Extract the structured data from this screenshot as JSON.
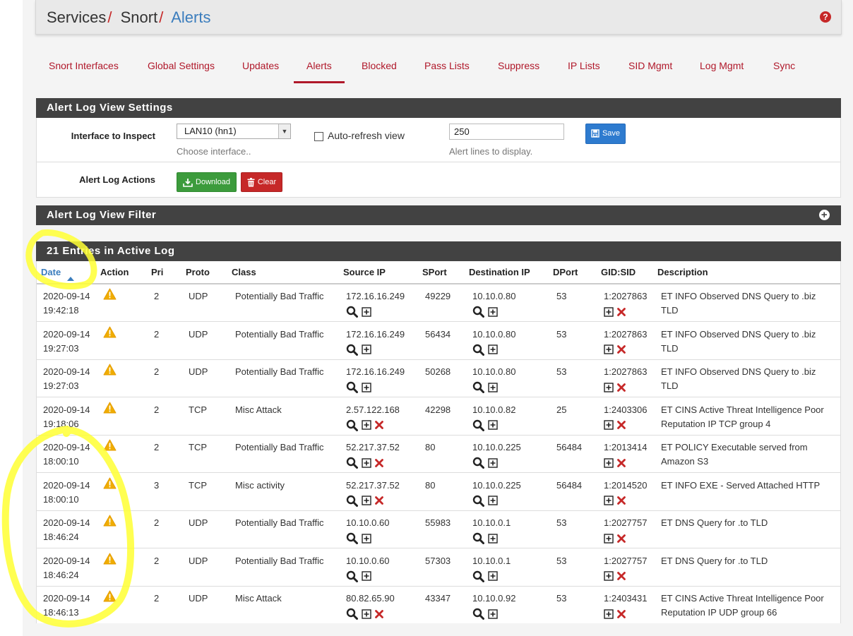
{
  "breadcrumb": {
    "part1": "Services",
    "part2": "Snort",
    "current": "Alerts",
    "separator": "/"
  },
  "tabs": [
    "Snort Interfaces",
    "Global Settings",
    "Updates",
    "Alerts",
    "Blocked",
    "Pass Lists",
    "Suppress",
    "IP Lists",
    "SID Mgmt",
    "Log Mgmt",
    "Sync"
  ],
  "active_tab": "Alerts",
  "settings": {
    "title": "Alert Log View Settings",
    "interface_label": "Interface to Inspect",
    "interface_value": "LAN10 (hn1)",
    "interface_hint": "Choose interface..",
    "autorefresh_label": "Auto-refresh view",
    "lines_value": "250",
    "lines_hint": "Alert lines to display.",
    "save_label": "Save",
    "actions_label": "Alert Log Actions",
    "download_label": "Download",
    "clear_label": "Clear"
  },
  "filter": {
    "title": "Alert Log View Filter"
  },
  "log": {
    "title": "21 Entries in Active Log",
    "columns": [
      "Date",
      "Action",
      "Pri",
      "Proto",
      "Class",
      "Source IP",
      "SPort",
      "Destination IP",
      "DPort",
      "GID:SID",
      "Description"
    ],
    "rows": [
      {
        "date": "2020-09-14",
        "time": "19:42:18",
        "pri": "2",
        "proto": "UDP",
        "class": "Potentially Bad Traffic",
        "src": "172.16.16.249",
        "src_block": false,
        "sport": "49229",
        "dst": "10.10.0.80",
        "dport": "53",
        "sid": "1:2027863",
        "desc1": "ET INFO Observed DNS Query to .biz",
        "desc2": "TLD"
      },
      {
        "date": "2020-09-14",
        "time": "19:27:03",
        "pri": "2",
        "proto": "UDP",
        "class": "Potentially Bad Traffic",
        "src": "172.16.16.249",
        "src_block": false,
        "sport": "56434",
        "dst": "10.10.0.80",
        "dport": "53",
        "sid": "1:2027863",
        "desc1": "ET INFO Observed DNS Query to .biz",
        "desc2": "TLD"
      },
      {
        "date": "2020-09-14",
        "time": "19:27:03",
        "pri": "2",
        "proto": "UDP",
        "class": "Potentially Bad Traffic",
        "src": "172.16.16.249",
        "src_block": false,
        "sport": "50268",
        "dst": "10.10.0.80",
        "dport": "53",
        "sid": "1:2027863",
        "desc1": "ET INFO Observed DNS Query to .biz",
        "desc2": "TLD"
      },
      {
        "date": "2020-09-14",
        "time": "19:18:06",
        "pri": "2",
        "proto": "TCP",
        "class": "Misc Attack",
        "src": "2.57.122.168",
        "src_block": true,
        "sport": "42298",
        "dst": "10.10.0.82",
        "dport": "25",
        "sid": "1:2403306",
        "desc1": "ET CINS Active Threat Intelligence Poor",
        "desc2": "Reputation IP TCP group 4"
      },
      {
        "date": "2020-09-14",
        "time": "18:00:10",
        "pri": "2",
        "proto": "TCP",
        "class": "Potentially Bad Traffic",
        "src": "52.217.37.52",
        "src_block": true,
        "sport": "80",
        "dst": "10.10.0.225",
        "dport": "56484",
        "sid": "1:2013414",
        "desc1": "ET POLICY Executable served from",
        "desc2": "Amazon S3"
      },
      {
        "date": "2020-09-14",
        "time": "18:00:10",
        "pri": "3",
        "proto": "TCP",
        "class": "Misc activity",
        "src": "52.217.37.52",
        "src_block": true,
        "sport": "80",
        "dst": "10.10.0.225",
        "dport": "56484",
        "sid": "1:2014520",
        "desc1": "ET INFO EXE - Served Attached HTTP",
        "desc2": ""
      },
      {
        "date": "2020-09-14",
        "time": "18:46:24",
        "pri": "2",
        "proto": "UDP",
        "class": "Potentially Bad Traffic",
        "src": "10.10.0.60",
        "src_block": false,
        "sport": "55983",
        "dst": "10.10.0.1",
        "dport": "53",
        "sid": "1:2027757",
        "desc1": "ET DNS Query for .to TLD",
        "desc2": ""
      },
      {
        "date": "2020-09-14",
        "time": "18:46:24",
        "pri": "2",
        "proto": "UDP",
        "class": "Potentially Bad Traffic",
        "src": "10.10.0.60",
        "src_block": false,
        "sport": "57303",
        "dst": "10.10.0.1",
        "dport": "53",
        "sid": "1:2027757",
        "desc1": "ET DNS Query for .to TLD",
        "desc2": ""
      },
      {
        "date": "2020-09-14",
        "time": "18:46:13",
        "pri": "2",
        "proto": "UDP",
        "class": "Misc Attack",
        "src": "80.82.65.90",
        "src_block": true,
        "sport": "43347",
        "dst": "10.10.0.92",
        "dport": "53",
        "sid": "1:2403431",
        "desc1": "ET CINS Active Threat Intelligence Poor",
        "desc2": "Reputation IP UDP group 66"
      }
    ]
  },
  "icons": {
    "action": "warning-icon",
    "lookup": "magnifier-icon",
    "add": "plus-square-icon",
    "remove": "x-icon"
  },
  "colors": {
    "accent_red": "#b0182a",
    "panel_header": "#424242",
    "link_blue": "#3b7dbd",
    "highlighter": "#ffff33"
  }
}
